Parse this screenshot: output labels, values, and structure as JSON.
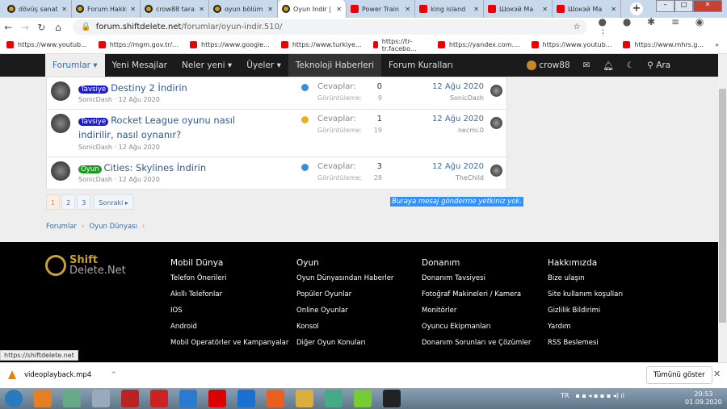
{
  "browser": {
    "tabs": [
      {
        "title": "dövüş sanatı",
        "icon": "forum"
      },
      {
        "title": "Forum Hakkı",
        "icon": "forum"
      },
      {
        "title": "crow88 tara",
        "icon": "forum"
      },
      {
        "title": "oyun bölüm",
        "icon": "forum"
      },
      {
        "title": "Oyun İndir |",
        "icon": "forum",
        "active": true
      },
      {
        "title": "Power Train",
        "icon": "youtube"
      },
      {
        "title": "king island",
        "icon": "youtube"
      },
      {
        "title": "Шокэй Ма",
        "icon": "youtube"
      },
      {
        "title": "Шокэй Ма",
        "icon": "youtube"
      }
    ],
    "url_domain": "forum.shiftdelete.net",
    "url_path": "/forumlar/oyun-indir.510/",
    "bookmarks": [
      "https://www.youtub...",
      "https://mgm.gov.tr/...",
      "https://www.google...",
      "https://www.turkiye...",
      "https://tr-tr.facebo...",
      "https://yandex.com....",
      "https://www.youtub...",
      "https://www.mhrs.g..."
    ],
    "status_url": "https://shiftdelete.net"
  },
  "nav": {
    "items": [
      "Forumlar",
      "Yeni Mesajlar",
      "Neler yeni",
      "Üyeler",
      "Teknoloji Haberleri",
      "Forum Kuralları"
    ],
    "user": "crow88",
    "search": "Ara"
  },
  "threads": [
    {
      "prefix": "Tavsiye",
      "prefix_color": "#1a1adb",
      "title": "Destiny 2 İndirin",
      "author": "SonicDash",
      "date": "12 Ağu 2020",
      "replies_label": "Cevaplar:",
      "replies": "0",
      "views_label": "Görüntüleme:",
      "views": "9",
      "last_date": "12 Ağu 2020",
      "last_user": "SonicDash"
    },
    {
      "prefix": "Tavsiye",
      "prefix_color": "#1a1adb",
      "title": "Rocket League oyunu nasıl indirilir, nasıl oynanır?",
      "author": "SonicDash",
      "date": "12 Ağu 2020",
      "replies_label": "Cevaplar:",
      "replies": "1",
      "views_label": "Görüntüleme:",
      "views": "19",
      "last_date": "12 Ağu 2020",
      "last_user": "necmi.0"
    },
    {
      "prefix": "Oyun",
      "prefix_color": "#1a9a1a",
      "title": "Cities: Skylines İndirin",
      "author": "SonicDash",
      "date": "12 Ağu 2020",
      "replies_label": "Cevaplar:",
      "replies": "3",
      "views_label": "Görüntüleme:",
      "views": "28",
      "last_date": "12 Ağu 2020",
      "last_user": "TheChild"
    }
  ],
  "pager": {
    "pages": [
      "1",
      "2",
      "3"
    ],
    "next": "Sonraki ▸"
  },
  "no_permission": "Buraya mesaj gönderme yetkiniz yok.",
  "breadcrumb": [
    "Forumlar",
    "Oyun Dünyası"
  ],
  "footer": {
    "logo": "Shift Delete.Net",
    "columns": [
      {
        "title": "Mobil Dünya",
        "links": [
          "Telefon Önerileri",
          "Akıllı Telefonlar",
          "IOS",
          "Android",
          "Mobil Operatörler ve Kampanyalar"
        ]
      },
      {
        "title": "Oyun",
        "links": [
          "Oyun Dünyasından Haberler",
          "Popüler Oyunlar",
          "Online Oyunlar",
          "Konsol",
          "Diğer Oyun Konuları"
        ]
      },
      {
        "title": "Donanım",
        "links": [
          "Donanım Tavsiyesi",
          "Fotoğraf Makineleri / Kamera",
          "Monitörler",
          "Oyuncu Ekipmanları",
          "Donanım Sorunları ve Çözümler"
        ]
      },
      {
        "title": "Hakkımızda",
        "links": [
          "Bize ulaşın",
          "Site kullanım koşulları",
          "Gizlilik Bildirimi",
          "Yardım",
          "RSS Beslemesi"
        ]
      }
    ]
  },
  "download": {
    "file": "videoplayback.mp4",
    "show_all": "Tümünü göster"
  },
  "taskbar": {
    "lang": "TR",
    "time": "20:53",
    "date": "01.09.2020"
  }
}
